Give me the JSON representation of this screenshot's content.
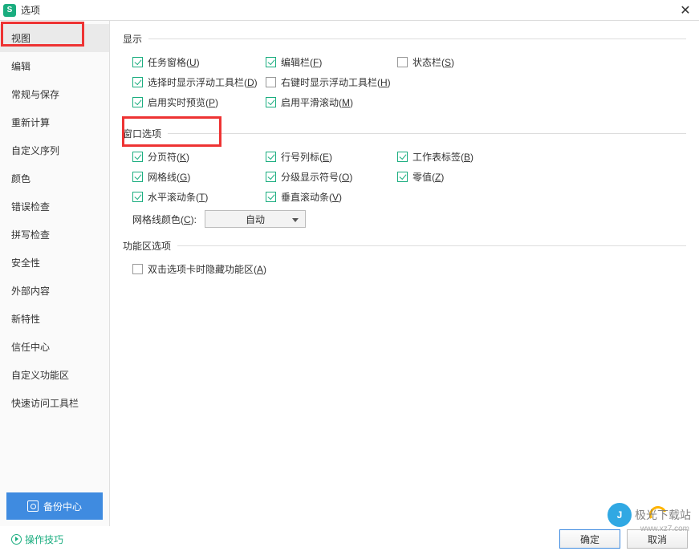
{
  "titlebar": {
    "title": "选项",
    "icon_letter": "S"
  },
  "sidebar": {
    "items": [
      {
        "label": "视图"
      },
      {
        "label": "编辑"
      },
      {
        "label": "常规与保存"
      },
      {
        "label": "重新计算"
      },
      {
        "label": "自定义序列"
      },
      {
        "label": "颜色"
      },
      {
        "label": "错误检查"
      },
      {
        "label": "拼写检查"
      },
      {
        "label": "安全性"
      },
      {
        "label": "外部内容"
      },
      {
        "label": "新特性"
      },
      {
        "label": "信任中心"
      },
      {
        "label": "自定义功能区"
      },
      {
        "label": "快速访问工具栏"
      }
    ],
    "backup_label": "备份中心"
  },
  "sections": {
    "display": {
      "title": "显示",
      "items": [
        {
          "label": "任务窗格(",
          "key": "U",
          "tail": ")",
          "checked": true
        },
        {
          "label": "编辑栏(",
          "key": "F",
          "tail": ")",
          "checked": true
        },
        {
          "label": "状态栏(",
          "key": "S",
          "tail": ")",
          "checked": false
        },
        {
          "label": "选择时显示浮动工具栏(",
          "key": "D",
          "tail": ")",
          "checked": true
        },
        {
          "label": "右键时显示浮动工具栏(",
          "key": "H",
          "tail": ")",
          "checked": false
        },
        {
          "label": "启用实时预览(",
          "key": "P",
          "tail": ")",
          "checked": true
        },
        {
          "label": "启用平滑滚动(",
          "key": "M",
          "tail": ")",
          "checked": true
        }
      ]
    },
    "window": {
      "title": "窗口选项",
      "items": [
        {
          "label": "分页符(",
          "key": "K",
          "tail": ")",
          "checked": true
        },
        {
          "label": "行号列标(",
          "key": "E",
          "tail": ")",
          "checked": true
        },
        {
          "label": "工作表标签(",
          "key": "B",
          "tail": ")",
          "checked": true
        },
        {
          "label": "网格线(",
          "key": "G",
          "tail": ")",
          "checked": true
        },
        {
          "label": "分级显示符号(",
          "key": "O",
          "tail": ")",
          "checked": true
        },
        {
          "label": "零值(",
          "key": "Z",
          "tail": ")",
          "checked": true
        },
        {
          "label": "水平滚动条(",
          "key": "T",
          "tail": ")",
          "checked": true
        },
        {
          "label": "垂直滚动条(",
          "key": "V",
          "tail": ")",
          "checked": true
        }
      ],
      "gridcolor_label": "网格线颜色(",
      "gridcolor_key": "C",
      "gridcolor_tail": "):",
      "gridcolor_value": "自动"
    },
    "ribbon": {
      "title": "功能区选项",
      "item": {
        "label": "双击选项卡时隐藏功能区(",
        "key": "A",
        "tail": ")",
        "checked": false
      }
    }
  },
  "footer": {
    "tips": "操作技巧",
    "ok": "确定",
    "cancel": "取消"
  },
  "watermark": {
    "text": "极光下载站",
    "sub": "www.xz7.com"
  }
}
